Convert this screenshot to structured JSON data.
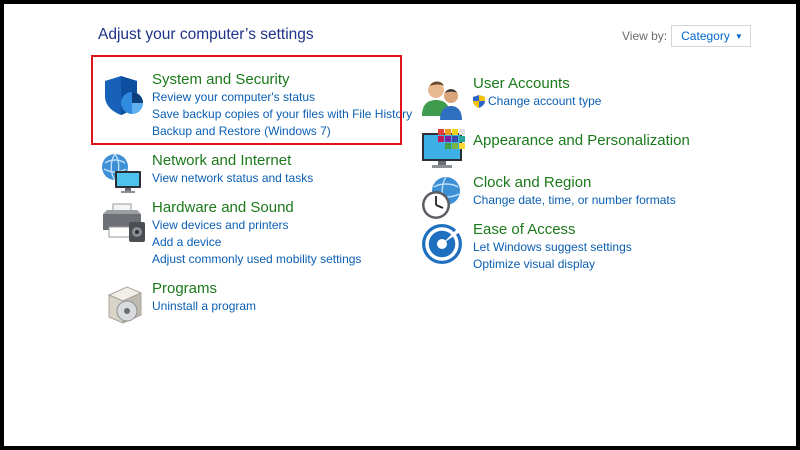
{
  "header": {
    "title": "Adjust your computer’s settings",
    "view_by_label": "View by:",
    "view_by_value": "Category"
  },
  "left_column": [
    {
      "title": "System and Security",
      "icon": "shield-icon",
      "links": [
        "Review your computer's status",
        "Save backup copies of your files with File History",
        "Backup and Restore (Windows 7)"
      ]
    },
    {
      "title": "Network and Internet",
      "icon": "network-globe-icon",
      "links": [
        "View network status and tasks"
      ]
    },
    {
      "title": "Hardware and Sound",
      "icon": "printer-icon",
      "links": [
        "View devices and printers",
        "Add a device",
        "Adjust commonly used mobility settings"
      ]
    },
    {
      "title": "Programs",
      "icon": "programs-disc-icon",
      "links": [
        "Uninstall a program"
      ]
    }
  ],
  "right_column": [
    {
      "title": "User Accounts",
      "icon": "users-icon",
      "links": [
        "Change account type"
      ]
    },
    {
      "title": "Appearance and Personalization",
      "icon": "monitor-palette-icon",
      "links": []
    },
    {
      "title": "Clock and Region",
      "icon": "clock-globe-icon",
      "links": [
        "Change date, time, or number formats"
      ]
    },
    {
      "title": "Ease of Access",
      "icon": "ease-of-access-icon",
      "links": [
        "Let Windows suggest settings",
        "Optimize visual display"
      ]
    }
  ],
  "colors": {
    "category_title": "#1b7a1b",
    "link": "#0b5fb3",
    "page_title": "#1e3287",
    "highlight_border": "#e0141d"
  }
}
